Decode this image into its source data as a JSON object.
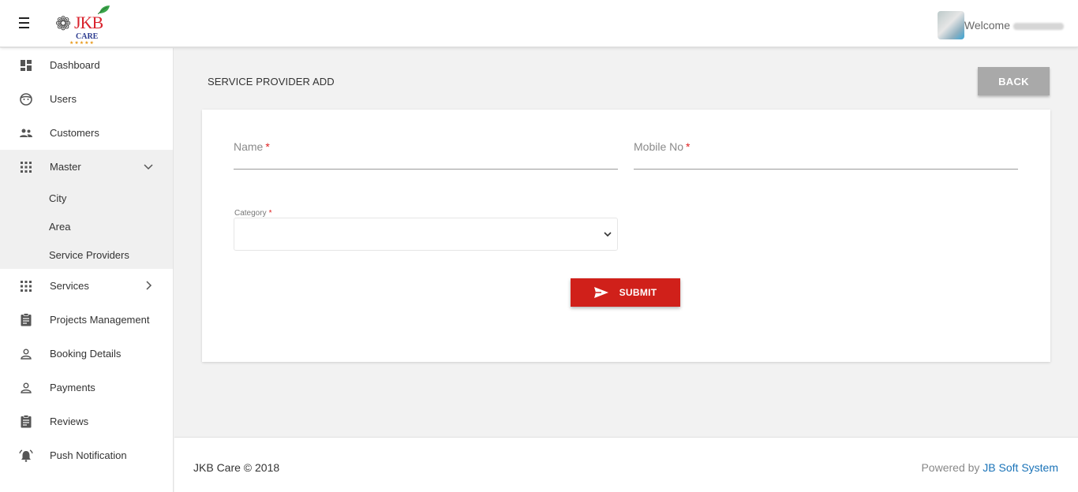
{
  "header": {
    "brand": {
      "name": "JKB",
      "sub": "CARE",
      "stars": "★★★★★"
    },
    "welcome": "Welcome",
    "user_name_redacted": true
  },
  "sidebar": {
    "items": [
      {
        "label": "Dashboard",
        "icon": "dashboard-icon"
      },
      {
        "label": "Users",
        "icon": "face-icon"
      },
      {
        "label": "Customers",
        "icon": "people-icon"
      },
      {
        "label": "Master",
        "icon": "apps-grid-icon",
        "expanded": true,
        "children": [
          {
            "label": "City"
          },
          {
            "label": "Area"
          },
          {
            "label": "Service Providers"
          }
        ]
      },
      {
        "label": "Services",
        "icon": "apps-grid-icon",
        "expanded": false
      },
      {
        "label": "Projects Management",
        "icon": "clipboard-icon"
      },
      {
        "label": "Booking Details",
        "icon": "person-outline-icon"
      },
      {
        "label": "Payments",
        "icon": "person-outline-icon"
      },
      {
        "label": "Reviews",
        "icon": "clipboard-icon"
      },
      {
        "label": "Push Notification",
        "icon": "alarm-bell-icon"
      }
    ]
  },
  "main": {
    "title": "SERVICE PROVIDER ADD",
    "back_label": "BACK",
    "form": {
      "name_label": "Name",
      "mobile_label": "Mobile No",
      "category_label": "Category",
      "required_mark": "*",
      "category_value": "",
      "submit_label": "SUBMIT"
    }
  },
  "footer": {
    "copyright": "JKB Care © 2018",
    "powered_by": "Powered by",
    "company": "JB Soft System"
  },
  "colors": {
    "accent_red": "#d0201a",
    "back_button": "#a9a9a9",
    "link_blue": "#1a73b8",
    "logo_red": "#d9232d",
    "logo_blue": "#2b3a8f"
  }
}
